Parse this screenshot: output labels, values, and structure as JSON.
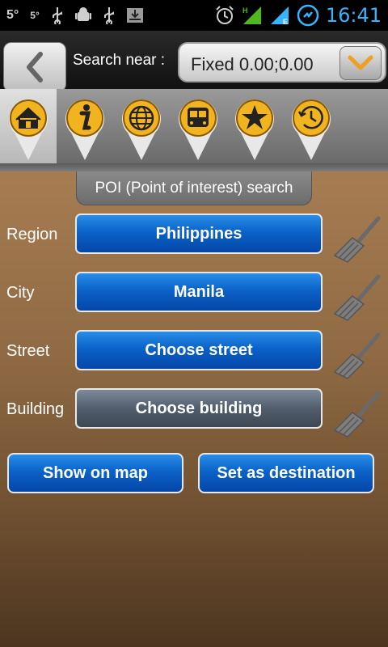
{
  "status_bar": {
    "temp1": "5°",
    "temp2": "5°",
    "time": "16:41"
  },
  "header": {
    "back_icon": "back-chevron-icon",
    "search_label": "Search near :",
    "search_value": "Fixed 0.00;0.00",
    "dropdown_icon": "chevron-down-icon"
  },
  "categories": [
    {
      "icon": "home-icon",
      "selected": true
    },
    {
      "icon": "info-icon",
      "selected": false
    },
    {
      "icon": "globe-icon",
      "selected": false
    },
    {
      "icon": "bus-icon",
      "selected": false
    },
    {
      "icon": "star-icon",
      "selected": false
    },
    {
      "icon": "history-clock-icon",
      "selected": false
    }
  ],
  "section_tab": "POI (Point of interest) search",
  "fields": {
    "region": {
      "label": "Region",
      "value": "Philippines"
    },
    "city": {
      "label": "City",
      "value": "Manila"
    },
    "street": {
      "label": "Street",
      "value": "Choose street"
    },
    "building": {
      "label": "Building",
      "value": "Choose building"
    }
  },
  "actions": {
    "show_on_map": "Show on map",
    "set_destination": "Set as destination"
  },
  "colors": {
    "accent_blue": "#0b62c8",
    "pin_gold": "#f2b320",
    "clock_blue": "#35b5ff"
  }
}
